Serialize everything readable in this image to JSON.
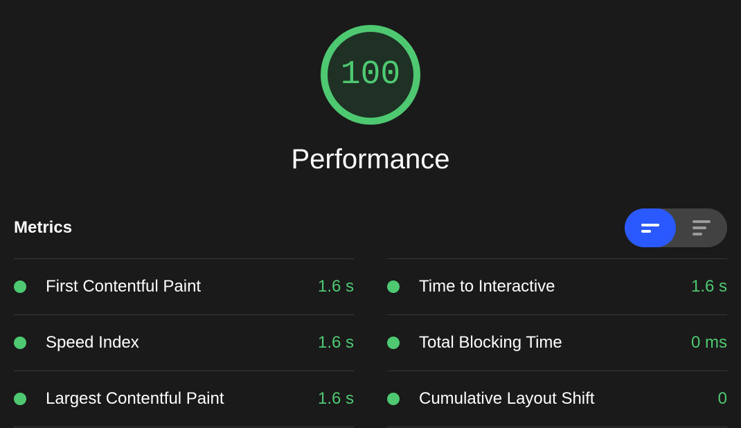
{
  "gauge": {
    "score": "100",
    "title": "Performance"
  },
  "metrics_title": "Metrics",
  "metrics": {
    "left": [
      {
        "label": "First Contentful Paint",
        "value": "1.6 s"
      },
      {
        "label": "Speed Index",
        "value": "1.6 s"
      },
      {
        "label": "Largest Contentful Paint",
        "value": "1.6 s"
      }
    ],
    "right": [
      {
        "label": "Time to Interactive",
        "value": "1.6 s"
      },
      {
        "label": "Total Blocking Time",
        "value": "0 ms"
      },
      {
        "label": "Cumulative Layout Shift",
        "value": "0"
      }
    ]
  },
  "colors": {
    "good": "#4ec972",
    "accent": "#2a5aff",
    "bg": "#1a1a1a"
  }
}
